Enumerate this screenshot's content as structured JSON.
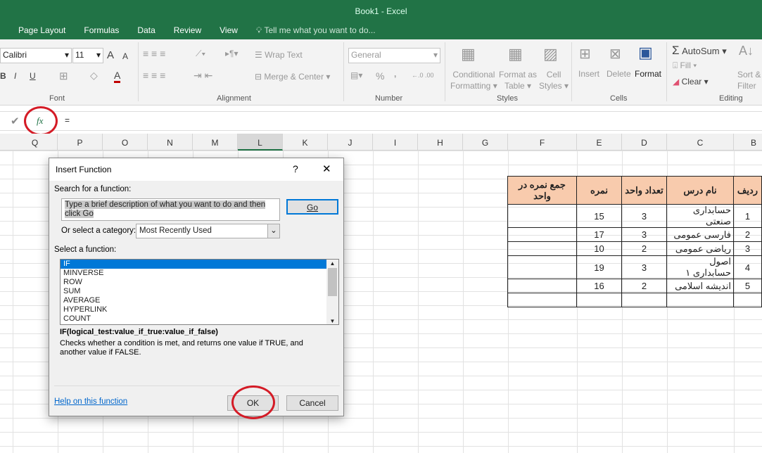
{
  "window": {
    "title": "Book1 - Excel"
  },
  "menu": {
    "tabs": [
      "Page Layout",
      "Formulas",
      "Data",
      "Review",
      "View"
    ],
    "tell_me": "Tell me what you want to do..."
  },
  "ribbon": {
    "font": {
      "name": "Calibri",
      "size": "11",
      "group": "Font",
      "bold": "B",
      "italic": "I",
      "underline": "U",
      "grow": "A",
      "shrink": "A",
      "color": "A"
    },
    "alignment": {
      "wrap_text": "Wrap Text",
      "merge_center": "Merge & Center",
      "group": "Alignment"
    },
    "number": {
      "format": "General",
      "percent": "%",
      "comma": ",",
      "group": "Number"
    },
    "styles": {
      "conditional": "Conditional",
      "conditional2": "Formatting",
      "format_table": "Format as",
      "format_table2": "Table",
      "cell_styles": "Cell",
      "cell_styles2": "Styles",
      "group": "Styles"
    },
    "cells": {
      "insert": "Insert",
      "delete": "Delete",
      "format": "Format",
      "group": "Cells"
    },
    "editing": {
      "autosum": "AutoSum",
      "fill": "Fill",
      "clear": "Clear",
      "sort": "Sort &",
      "filter": "Filter",
      "group": "Editing"
    }
  },
  "formula_bar": {
    "fx": "fx",
    "value": "="
  },
  "columns": [
    "Q",
    "P",
    "O",
    "N",
    "M",
    "L",
    "K",
    "J",
    "I",
    "H",
    "G",
    "F",
    "E",
    "D",
    "C",
    "B"
  ],
  "selected_column": "L",
  "sheet": {
    "headers": [
      "جمع نمره در واحد",
      "نمره",
      "تعداد واحد",
      "نام درس",
      "ردیف"
    ],
    "rows": [
      [
        "",
        "15",
        "3",
        "حسابداری صنعتی",
        "1"
      ],
      [
        "",
        "17",
        "3",
        "فارسی عمومی",
        "2"
      ],
      [
        "",
        "10",
        "2",
        "ریاضی عمومی",
        "3"
      ],
      [
        "",
        "19",
        "3",
        "اصول حسابداری ۱",
        "4"
      ],
      [
        "",
        "16",
        "2",
        "اندیشه اسلامی",
        "5"
      ],
      [
        "",
        "",
        "",
        "",
        ""
      ]
    ],
    "header_color": "#f8cbad"
  },
  "dialog": {
    "title": "Insert Function",
    "help": "?",
    "close": "✕",
    "search_label": "Search for a function:",
    "search_value": "Type a brief description of what you want to do and then click Go",
    "go": "Go",
    "category_label": "Or select a category:",
    "category_value": "Most Recently Used",
    "select_label": "Select a function:",
    "functions": [
      "IF",
      "MINVERSE",
      "ROW",
      "SUM",
      "AVERAGE",
      "HYPERLINK",
      "COUNT"
    ],
    "selected_function": "IF",
    "syntax": "IF(logical_test:value_if_true:value_if_false)",
    "description": "Checks whether a condition is met, and returns one value if TRUE, and another value if FALSE.",
    "help_link": "Help on this function",
    "ok": "OK",
    "cancel": "Cancel"
  }
}
